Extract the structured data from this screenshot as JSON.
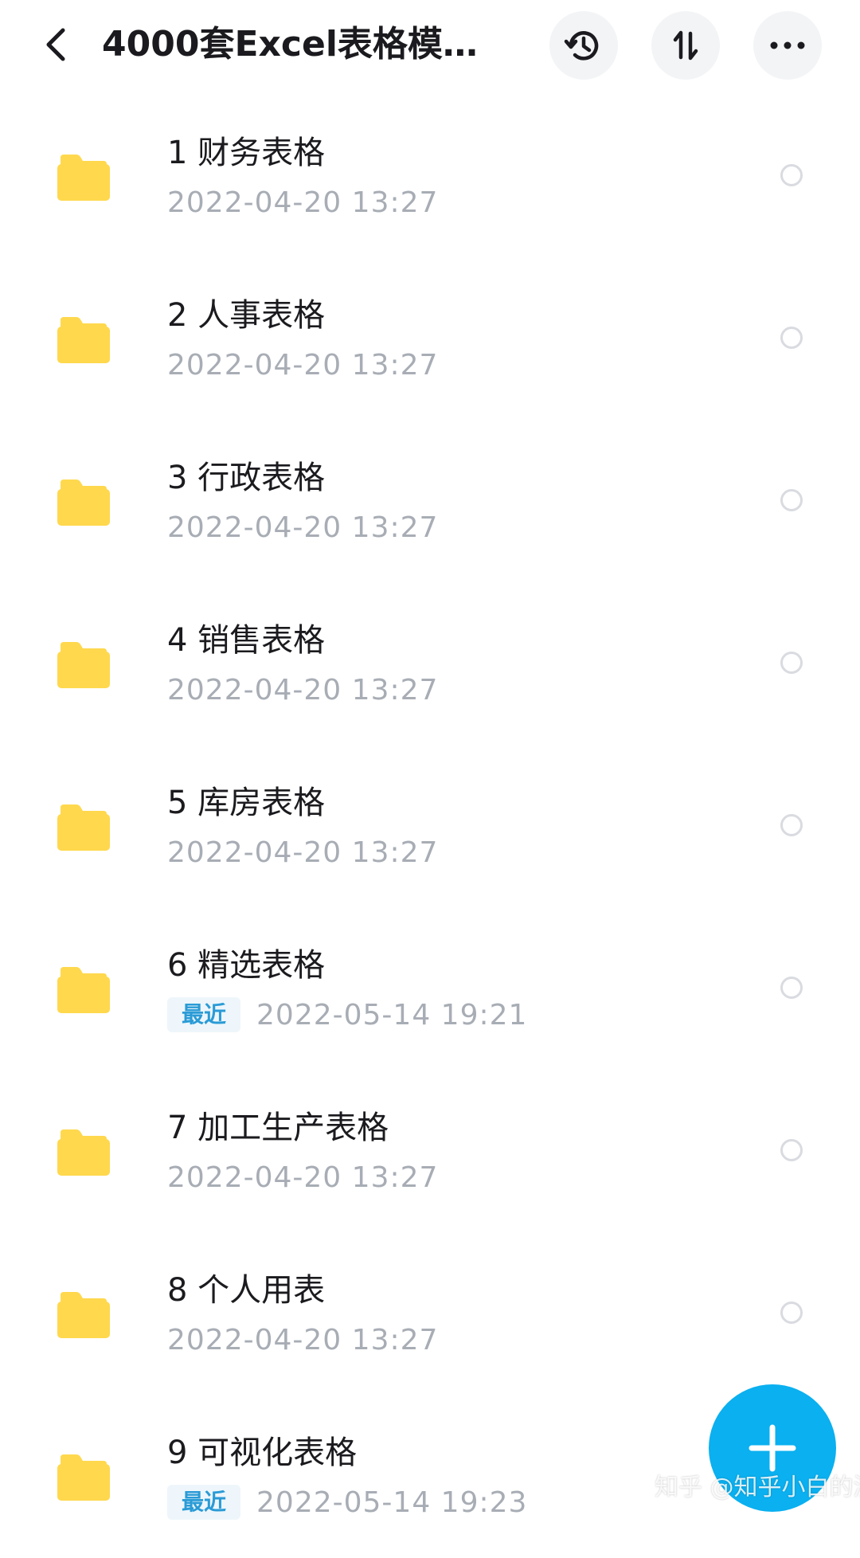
{
  "header": {
    "title": "4000套Excel表格模…"
  },
  "icons": {
    "back": "chevron-left-icon",
    "history": "history-clock-icon",
    "sort": "sort-arrows-icon",
    "more": "more-dots-icon",
    "folder": "folder-icon",
    "fab": "plus-icon"
  },
  "colors": {
    "folder": "#FFD84D",
    "badge_text": "#2A9BD6",
    "fab": "#0AB0F0"
  },
  "files": [
    {
      "name": "1 财务表格",
      "recent": "",
      "date": "2022-04-20  13:27"
    },
    {
      "name": "2 人事表格",
      "recent": "",
      "date": "2022-04-20  13:27"
    },
    {
      "name": "3 行政表格",
      "recent": "",
      "date": "2022-04-20  13:27"
    },
    {
      "name": "4 销售表格",
      "recent": "",
      "date": "2022-04-20  13:27"
    },
    {
      "name": "5 库房表格",
      "recent": "",
      "date": "2022-04-20  13:27"
    },
    {
      "name": "6 精选表格",
      "recent": "最近",
      "date": "2022-05-14  19:21"
    },
    {
      "name": "7 加工生产表格",
      "recent": "",
      "date": "2022-04-20  13:27"
    },
    {
      "name": "8 个人用表",
      "recent": "",
      "date": "2022-04-20  13:27"
    },
    {
      "name": "9 可视化表格",
      "recent": "最近",
      "date": "2022-05-14  19:23"
    }
  ],
  "watermark": "知乎 @知乎小白的测评"
}
